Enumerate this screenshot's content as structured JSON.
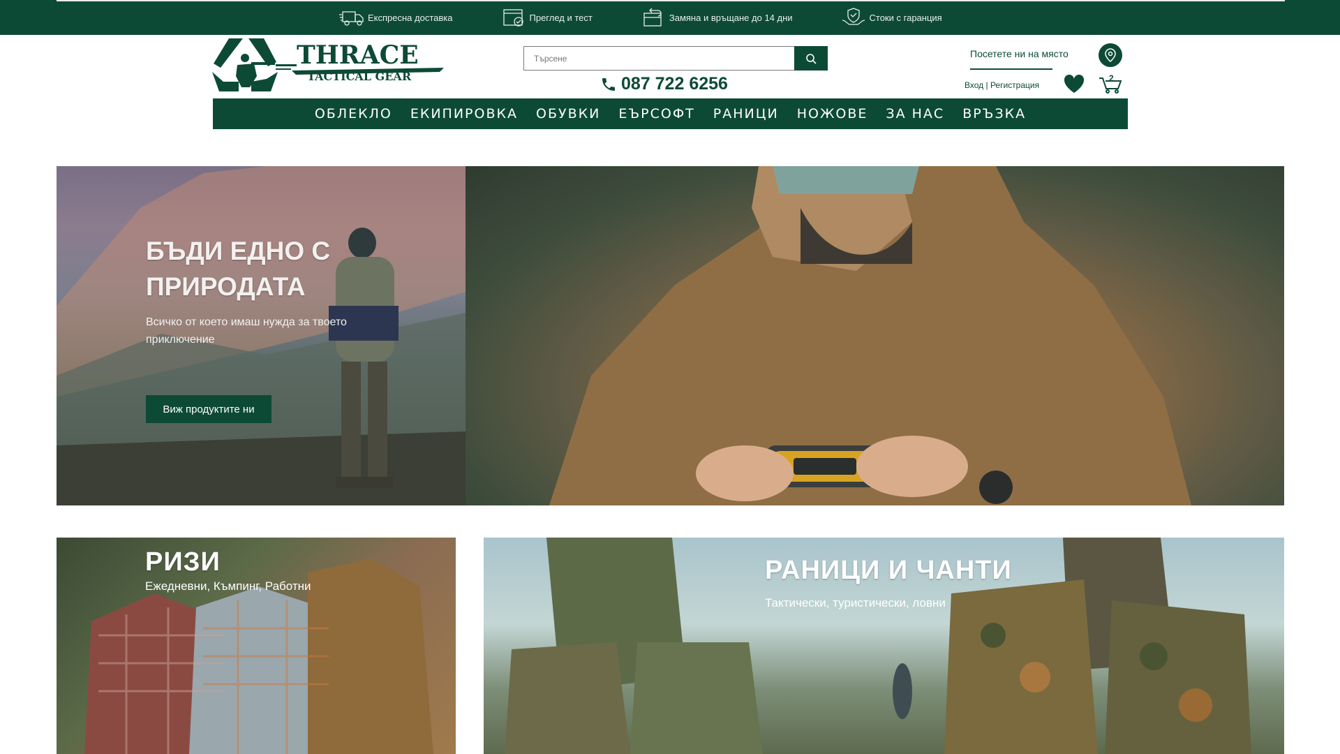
{
  "perks": [
    {
      "icon": "truck-icon",
      "label": "Експресна доставка"
    },
    {
      "icon": "box-check-icon",
      "label": "Преглед и тест"
    },
    {
      "icon": "return-box-icon",
      "label": "Замяна и връщане до 14 дни"
    },
    {
      "icon": "warranty-hands-icon",
      "label": "Стоки с гаранция"
    }
  ],
  "header": {
    "logo_title": "THRACE",
    "logo_subtitle": "TACTICAL GEAR",
    "search_placeholder": "Търсене",
    "phone": "087 722 6256",
    "visit_label": "Посетете ни на място",
    "login_label": "Вход",
    "auth_separator": " | ",
    "register_label": "Регистрация",
    "cart_count": "2"
  },
  "nav": [
    "ОБЛЕКЛО",
    "ЕКИПИРОВКА",
    "ОБУВКИ",
    "ЕЪРСОФТ",
    "РАНИЦИ",
    "НОЖОВЕ",
    "ЗА НАС",
    "ВРЪЗКА"
  ],
  "hero": {
    "title": "БЪДИ ЕДНО С ПРИРОДАТА",
    "subtitle": "Всичко от което имаш нужда за твоето приключение",
    "button": "Виж продуктите ни"
  },
  "tiles": {
    "shirts": {
      "title": "РИЗИ",
      "subtitle": "Ежедневни, Къмпинг, Работни"
    },
    "packs": {
      "title": "РАНИЦИ И ЧАНТИ",
      "subtitle": "Тактически, туристически, ловни"
    }
  },
  "colors": {
    "brand": "#0d4a36",
    "white": "#ffffff"
  }
}
